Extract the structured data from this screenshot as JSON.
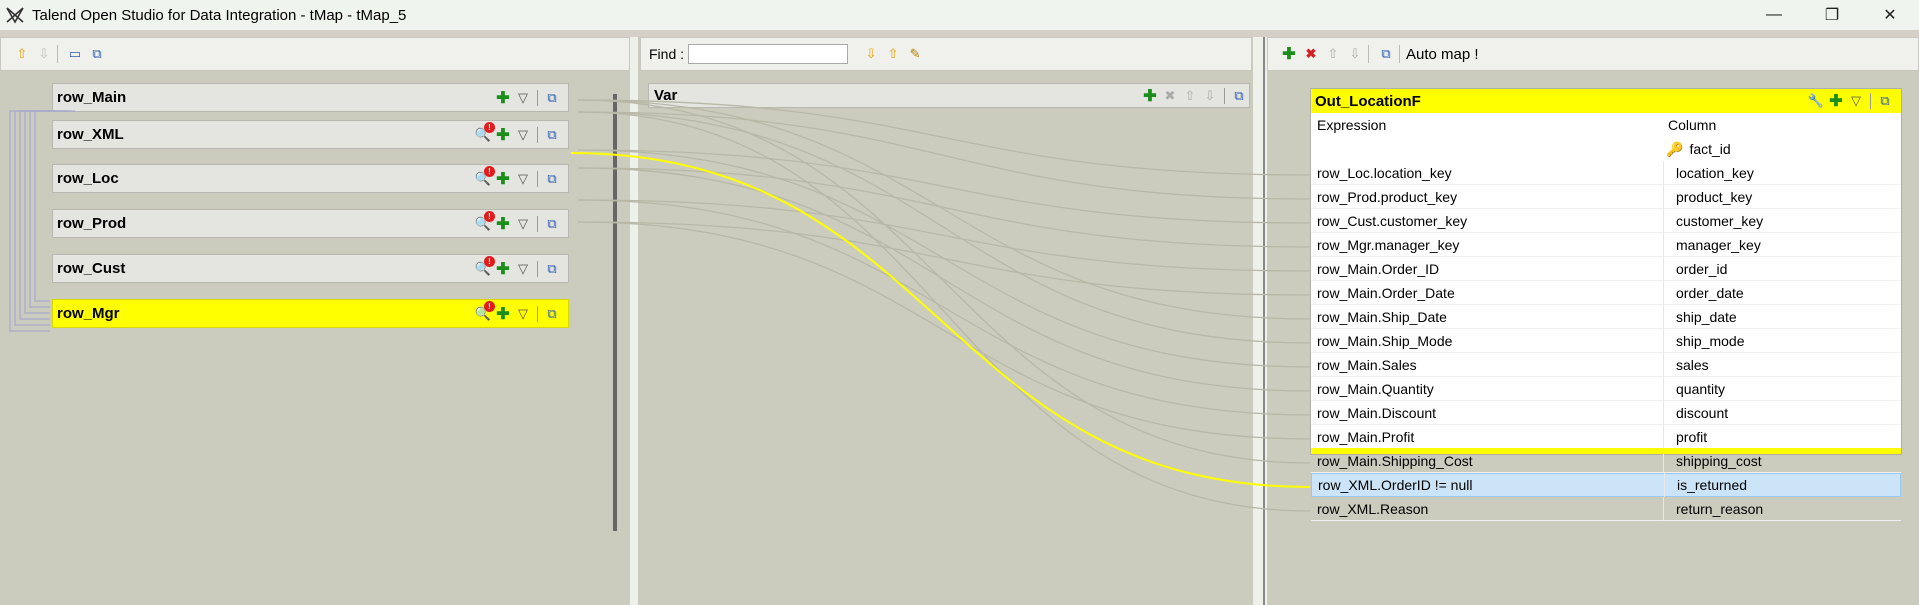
{
  "window": {
    "title": "Talend Open Studio for Data Integration - tMap - tMap_5",
    "minimize": "—",
    "maximize": "❐",
    "close": "✕"
  },
  "left_panel": {
    "tables": [
      {
        "name": "row_Main",
        "warn": false,
        "selected": false
      },
      {
        "name": "row_XML",
        "warn": true,
        "selected": false
      },
      {
        "name": "row_Loc",
        "warn": true,
        "selected": false
      },
      {
        "name": "row_Prod",
        "warn": true,
        "selected": false
      },
      {
        "name": "row_Cust",
        "warn": true,
        "selected": false
      },
      {
        "name": "row_Mgr",
        "warn": true,
        "selected": true
      }
    ]
  },
  "middle_panel": {
    "find_label": "Find :",
    "find_value": "",
    "var_table": "Var"
  },
  "right_panel": {
    "auto_map": "Auto map !",
    "output": {
      "name": "Out_LocationF",
      "expression_header": "Expression",
      "column_header": "Column",
      "key_column": "fact_id",
      "rows": [
        {
          "expression": "row_Loc.location_key",
          "column": "location_key"
        },
        {
          "expression": "row_Prod.product_key",
          "column": "product_key"
        },
        {
          "expression": "row_Cust.customer_key",
          "column": "customer_key"
        },
        {
          "expression": "row_Mgr.manager_key",
          "column": "manager_key"
        },
        {
          "expression": "row_Main.Order_ID",
          "column": "order_id"
        },
        {
          "expression": "row_Main.Order_Date",
          "column": "order_date"
        },
        {
          "expression": "row_Main.Ship_Date",
          "column": "ship_date"
        },
        {
          "expression": "row_Main.Ship_Mode",
          "column": "ship_mode"
        },
        {
          "expression": "row_Main.Sales",
          "column": "sales"
        },
        {
          "expression": "row_Main.Quantity",
          "column": "quantity"
        },
        {
          "expression": "row_Main.Discount",
          "column": "discount"
        },
        {
          "expression": "row_Main.Profit",
          "column": "profit"
        },
        {
          "expression": "row_Main.Shipping_Cost",
          "column": "shipping_cost"
        },
        {
          "expression": "row_XML.OrderID != null",
          "column": "is_returned",
          "selected": true
        },
        {
          "expression": "row_XML.Reason",
          "column": "return_reason"
        }
      ]
    }
  },
  "colors": {
    "selected_table": "#ffff00",
    "link_line": "#ffff00",
    "panel_bg": "#ccccbe"
  }
}
